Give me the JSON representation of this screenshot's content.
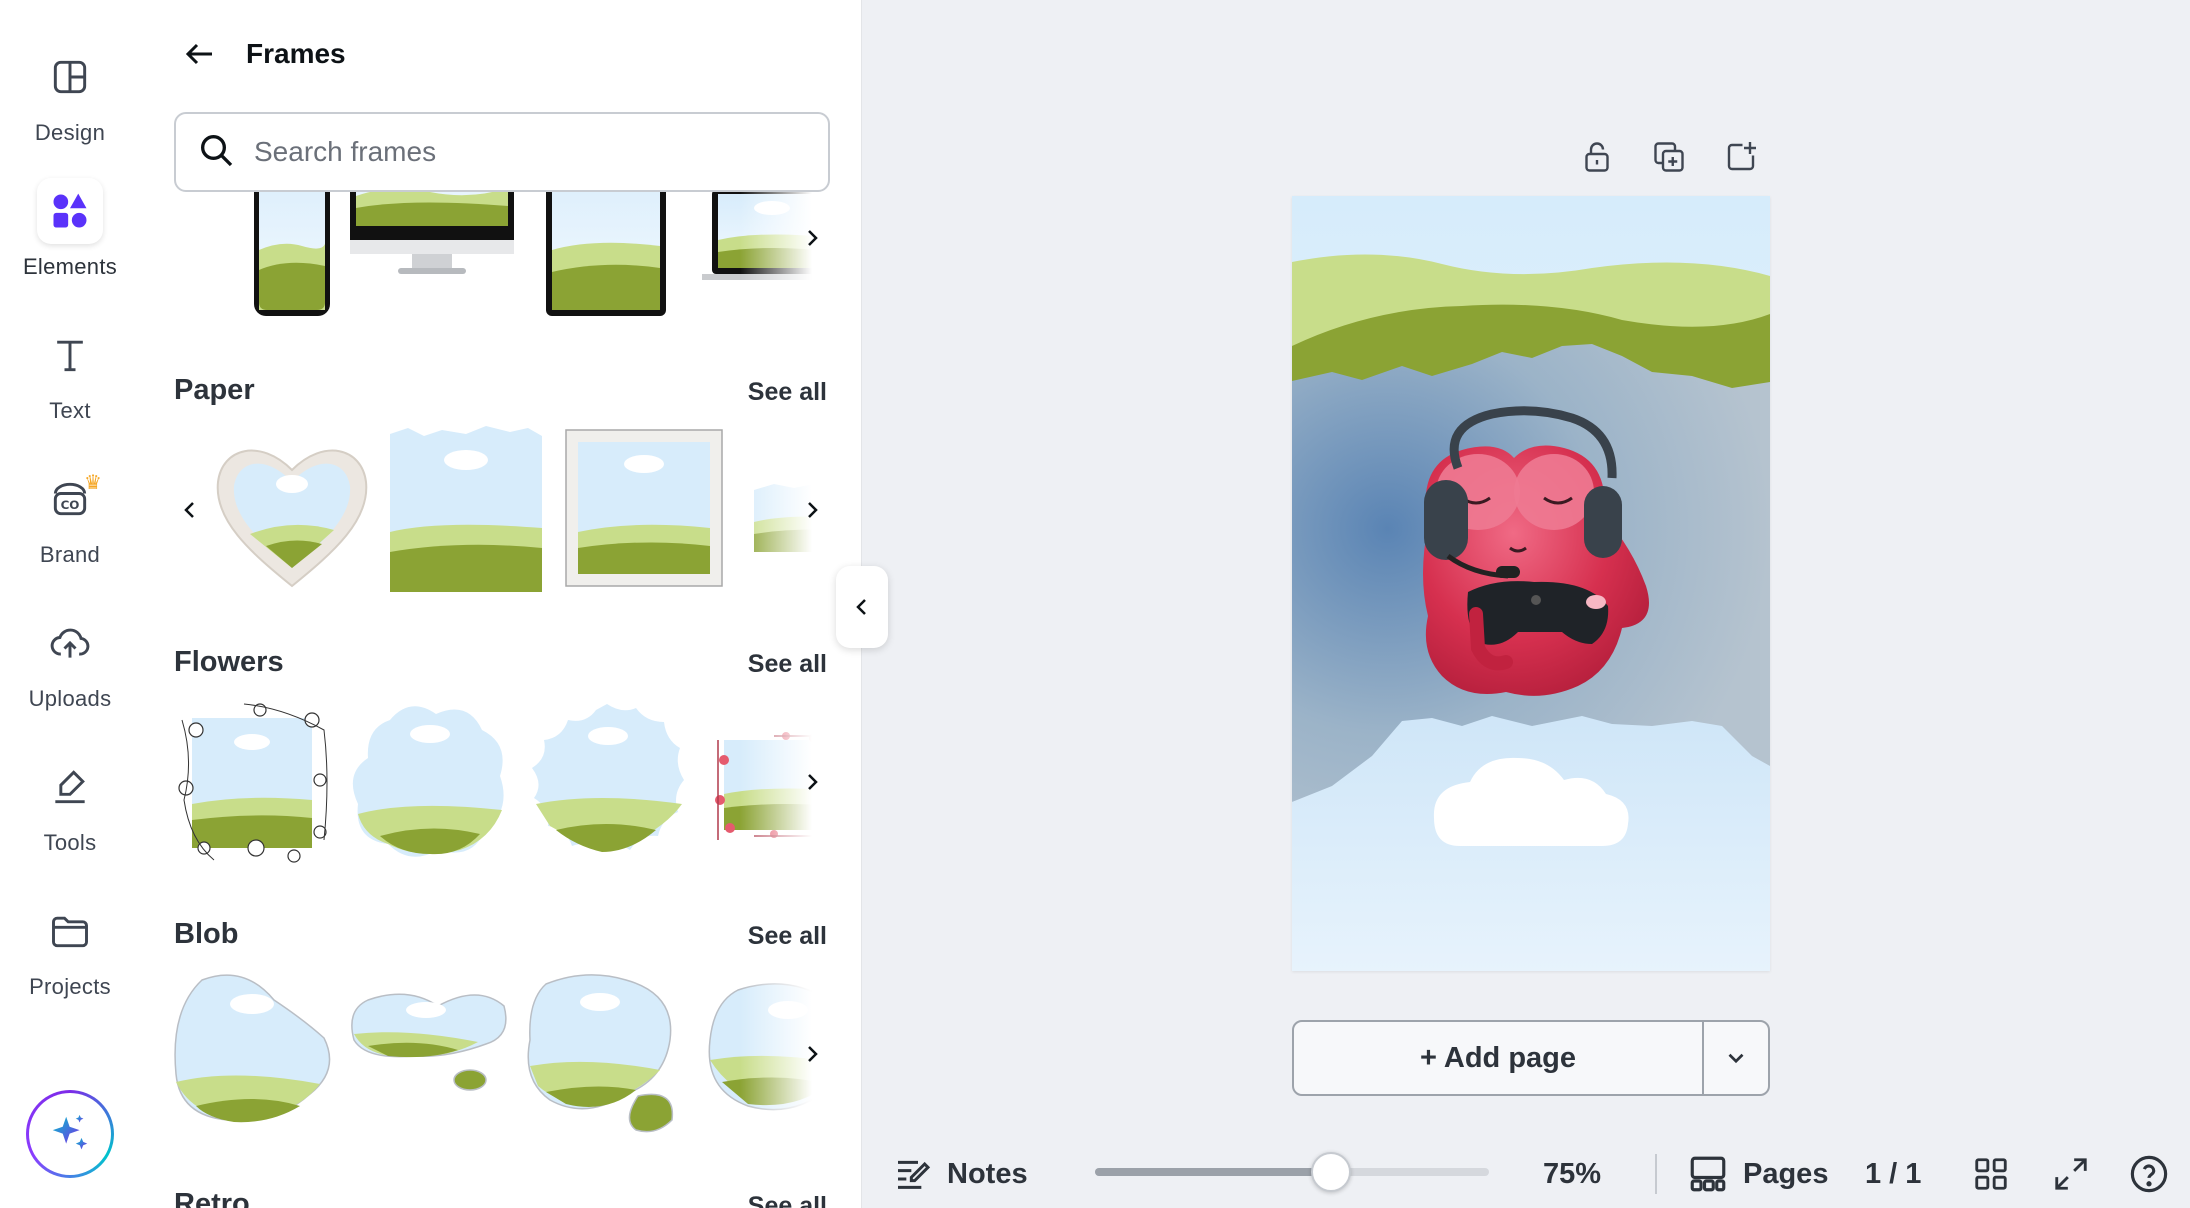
{
  "rail": {
    "items": [
      {
        "label": "Design",
        "icon": "layout-icon"
      },
      {
        "label": "Elements",
        "icon": "shapes-icon"
      },
      {
        "label": "Text",
        "icon": "text-icon"
      },
      {
        "label": "Brand",
        "icon": "brand-icon"
      },
      {
        "label": "Uploads",
        "icon": "cloud-upload-icon"
      },
      {
        "label": "Tools",
        "icon": "pen-tool-icon"
      },
      {
        "label": "Projects",
        "icon": "folder-icon"
      }
    ],
    "active": "Elements"
  },
  "panel": {
    "title": "Frames",
    "search_placeholder": "Search frames",
    "sections": [
      {
        "title": "Paper",
        "see_all": "See all"
      },
      {
        "title": "Flowers",
        "see_all": "See all"
      },
      {
        "title": "Blob",
        "see_all": "See all"
      },
      {
        "title": "Retro",
        "see_all": "See all"
      }
    ]
  },
  "canvas": {
    "add_page": "+ Add page"
  },
  "bottom_bar": {
    "notes": "Notes",
    "zoom": "75%",
    "zoom_level": 0.6,
    "pages": "Pages",
    "page_count": "1 / 1"
  },
  "colors": {
    "accent": "#8b3dff",
    "elements_icon": "#5a32fa",
    "grass_light": "#c8dd8a",
    "grass_dark": "#8ba334",
    "sky": "#d7ecfb"
  }
}
